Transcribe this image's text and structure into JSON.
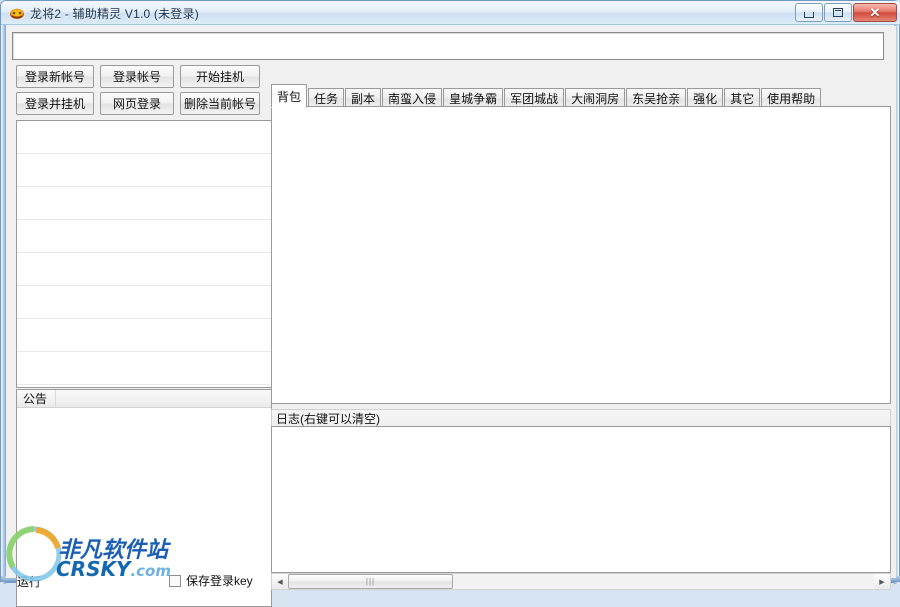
{
  "window": {
    "title": "龙将2 - 辅助精灵 V1.0 (未登录)",
    "icon": "app-icon",
    "buttons": {
      "minimize": "minimize",
      "maximize": "maximize",
      "close": "✕"
    }
  },
  "top_input": {
    "value": "",
    "placeholder": ""
  },
  "left": {
    "buttons_row1": [
      {
        "label": "登录新帐号"
      },
      {
        "label": "登录帐号"
      },
      {
        "label": "开始挂机"
      }
    ],
    "buttons_row2": [
      {
        "label": "登录并挂机"
      },
      {
        "label": "网页登录"
      },
      {
        "label": "删除当前帐号"
      }
    ],
    "account_list": {
      "rows": [
        "",
        "",
        "",
        "",
        "",
        "",
        "",
        ""
      ]
    },
    "notice": {
      "header": "公告",
      "body": ""
    }
  },
  "right": {
    "tabs": [
      {
        "label": "背包",
        "active": true
      },
      {
        "label": "任务",
        "active": false
      },
      {
        "label": "副本",
        "active": false
      },
      {
        "label": "南蛮入侵",
        "active": false
      },
      {
        "label": "皇城争霸",
        "active": false
      },
      {
        "label": "军团城战",
        "active": false
      },
      {
        "label": "大闹洞房",
        "active": false
      },
      {
        "label": "东吴抢亲",
        "active": false
      },
      {
        "label": "强化",
        "active": false
      },
      {
        "label": "其它",
        "active": false
      },
      {
        "label": "使用帮助",
        "active": false
      }
    ],
    "tab_content": "",
    "log_label": "日志(右键可以清空)",
    "log_content": "",
    "scrollbar": {
      "left_arrow": "◀",
      "right_arrow": "▶",
      "grip": "|||"
    }
  },
  "status": {
    "text": "运行",
    "save_key_label": "保存登录key",
    "save_key_checked": false
  },
  "watermark": {
    "line1": "非凡软件站",
    "line2": "CRSKY",
    "line2_suffix": ".com"
  },
  "colors": {
    "accent": "#1a5fb4",
    "titlebar": "#dcebf8",
    "close_red": "#cf4a38",
    "frame": "#6f98c4"
  }
}
